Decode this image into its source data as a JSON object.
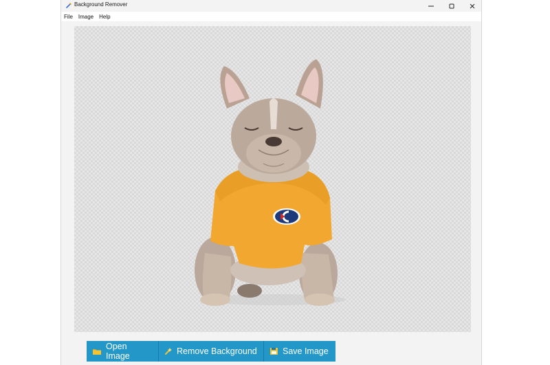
{
  "window": {
    "title": "Background Remover"
  },
  "menu": {
    "items": [
      {
        "label": "File"
      },
      {
        "label": "Image"
      },
      {
        "label": "Help"
      }
    ]
  },
  "canvas": {
    "subject": "french-bulldog-in-yellow-shirt",
    "background": "transparent-checkerboard"
  },
  "toolbar": {
    "open_label": "Open Image",
    "remove_label": "Remove Background",
    "save_label": "Save Image"
  },
  "colors": {
    "button_bg": "#2497c9",
    "button_text": "#ffffff",
    "shirt": "#f2a830"
  }
}
